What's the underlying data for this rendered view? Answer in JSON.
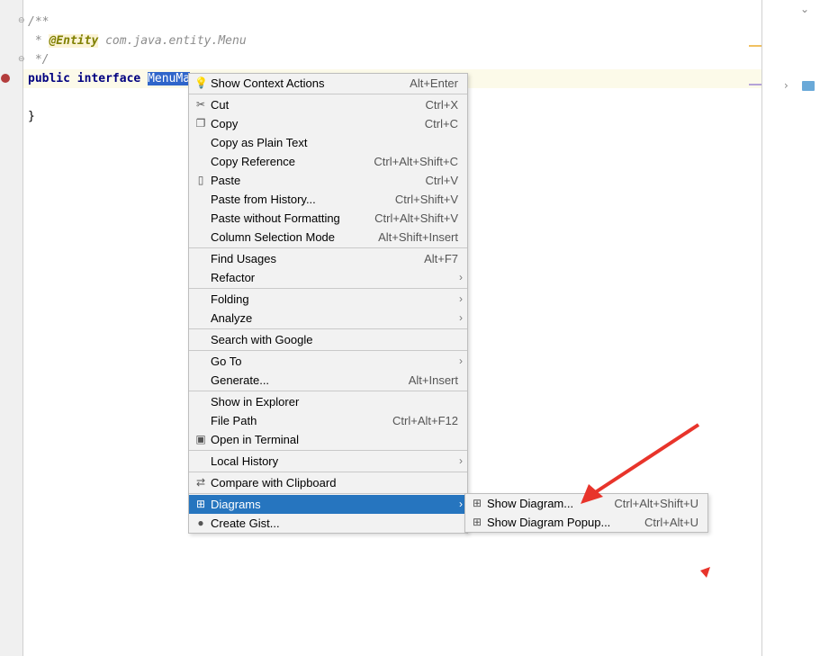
{
  "editor": {
    "lines": [
      {
        "parts": [
          {
            "t": "/**",
            "c": "comment"
          }
        ]
      },
      {
        "parts": [
          {
            "t": " * ",
            "c": "comment"
          },
          {
            "t": "@Entity",
            "c": "annot"
          },
          {
            "t": " com.java.entity.Menu",
            "c": "comment"
          }
        ]
      },
      {
        "parts": [
          {
            "t": " */",
            "c": "comment"
          }
        ]
      },
      {
        "parts": [
          {
            "t": "public interface ",
            "c": "kw"
          },
          {
            "t": "MenuMa",
            "c": "sel"
          }
        ]
      },
      {
        "parts": []
      },
      {
        "parts": [
          {
            "t": "}",
            "c": ""
          }
        ]
      }
    ]
  },
  "context_menu": {
    "groups": [
      [
        {
          "label": "Show Context Actions",
          "shortcut": "Alt+Enter",
          "icon": "bulb-icon",
          "glyph": "💡"
        }
      ],
      [
        {
          "label": "Cut",
          "shortcut": "Ctrl+X",
          "icon": "scissors-icon",
          "glyph": "✂"
        },
        {
          "label": "Copy",
          "shortcut": "Ctrl+C",
          "icon": "copy-icon",
          "glyph": "❐"
        },
        {
          "label": "Copy as Plain Text",
          "shortcut": ""
        },
        {
          "label": "Copy Reference",
          "shortcut": "Ctrl+Alt+Shift+C"
        },
        {
          "label": "Paste",
          "shortcut": "Ctrl+V",
          "icon": "clipboard-icon",
          "glyph": "▯"
        },
        {
          "label": "Paste from History...",
          "shortcut": "Ctrl+Shift+V"
        },
        {
          "label": "Paste without Formatting",
          "shortcut": "Ctrl+Alt+Shift+V"
        },
        {
          "label": "Column Selection Mode",
          "shortcut": "Alt+Shift+Insert"
        }
      ],
      [
        {
          "label": "Find Usages",
          "shortcut": "Alt+F7"
        },
        {
          "label": "Refactor",
          "submenu": true
        }
      ],
      [
        {
          "label": "Folding",
          "submenu": true
        },
        {
          "label": "Analyze",
          "submenu": true
        }
      ],
      [
        {
          "label": "Search with Google",
          "shortcut": ""
        }
      ],
      [
        {
          "label": "Go To",
          "submenu": true
        },
        {
          "label": "Generate...",
          "shortcut": "Alt+Insert"
        }
      ],
      [
        {
          "label": "Show in Explorer",
          "shortcut": ""
        },
        {
          "label": "File Path",
          "shortcut": "Ctrl+Alt+F12"
        },
        {
          "label": "Open in Terminal",
          "shortcut": "",
          "icon": "terminal-icon",
          "glyph": "▣"
        }
      ],
      [
        {
          "label": "Local History",
          "submenu": true
        }
      ],
      [
        {
          "label": "Compare with Clipboard",
          "shortcut": "",
          "icon": "compare-icon",
          "glyph": "⇄"
        }
      ],
      [
        {
          "label": "Diagrams",
          "submenu": true,
          "active": true,
          "icon": "diagram-icon",
          "glyph": "⊞"
        },
        {
          "label": "Create Gist...",
          "shortcut": "",
          "icon": "github-icon",
          "glyph": "●"
        }
      ]
    ]
  },
  "submenu": {
    "items": [
      {
        "label": "Show Diagram...",
        "shortcut": "Ctrl+Alt+Shift+U",
        "icon": "diagram-icon",
        "glyph": "⊞"
      },
      {
        "label": "Show Diagram Popup...",
        "shortcut": "Ctrl+Alt+U",
        "icon": "diagram-icon",
        "glyph": "⊞"
      }
    ]
  },
  "colors": {
    "accent": "#2675bf",
    "annotation_arrow": "#e8342b"
  }
}
